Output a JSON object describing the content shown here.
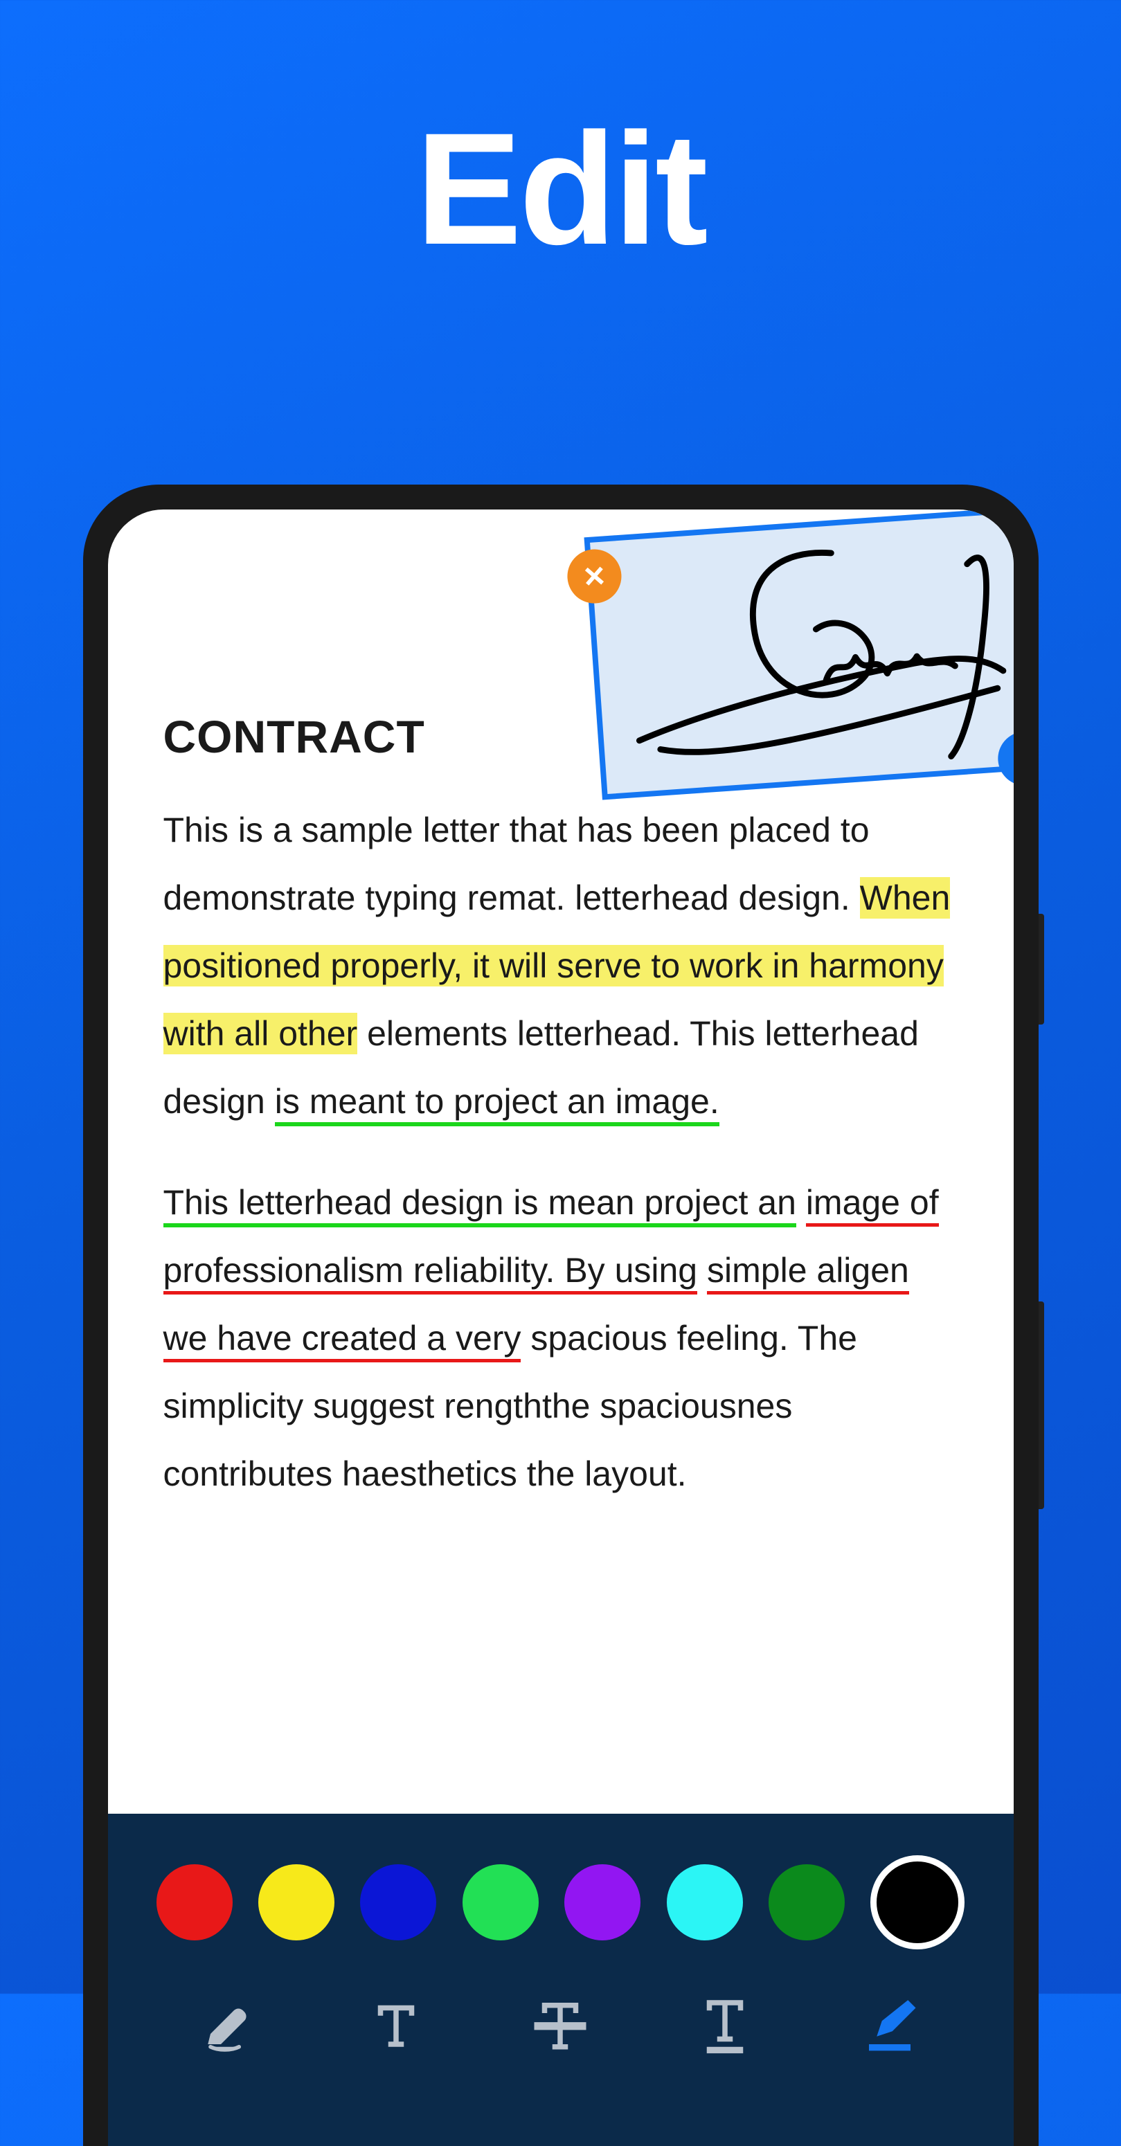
{
  "hero": {
    "title": "Edit"
  },
  "document": {
    "title": "CONTRACT",
    "p1_a": "This is a sample letter that has been placed to demonstrate typing remat. letterhead design. ",
    "p1_b": "When positioned properly, it will serve to work in harmony with all other",
    "p1_c": " elements letterhead. This letterhead design ",
    "p1_d": "is meant to project an image.",
    "p2_a": "This letterhead design is mean project an",
    "p2_b": " ",
    "p2_c": "image of professionalism reliability. By using",
    "p2_d": " ",
    "p2_e": "simple aligen we have created a very",
    "p2_f": " spacious feeling. The simplicity suggest rengththe spaciousnes contributes haesthetics the layout."
  },
  "signature": {
    "label": "Signature",
    "delete_label": "×"
  },
  "toolbar": {
    "colors": [
      {
        "name": "red",
        "hex": "#e81818",
        "selected": false
      },
      {
        "name": "yellow",
        "hex": "#f7e91a",
        "selected": false
      },
      {
        "name": "blue",
        "hex": "#0b16d6",
        "selected": false
      },
      {
        "name": "green",
        "hex": "#22e055",
        "selected": false
      },
      {
        "name": "purple",
        "hex": "#9216f2",
        "selected": false
      },
      {
        "name": "cyan",
        "hex": "#2bf5f5",
        "selected": false
      },
      {
        "name": "dark-green",
        "hex": "#0b8a1c",
        "selected": false
      },
      {
        "name": "black",
        "hex": "#000000",
        "selected": true
      }
    ],
    "tools": [
      {
        "name": "highlighter",
        "active": false
      },
      {
        "name": "text",
        "active": false
      },
      {
        "name": "strike",
        "active": false
      },
      {
        "name": "underline",
        "active": false
      },
      {
        "name": "signature",
        "active": true
      }
    ]
  }
}
